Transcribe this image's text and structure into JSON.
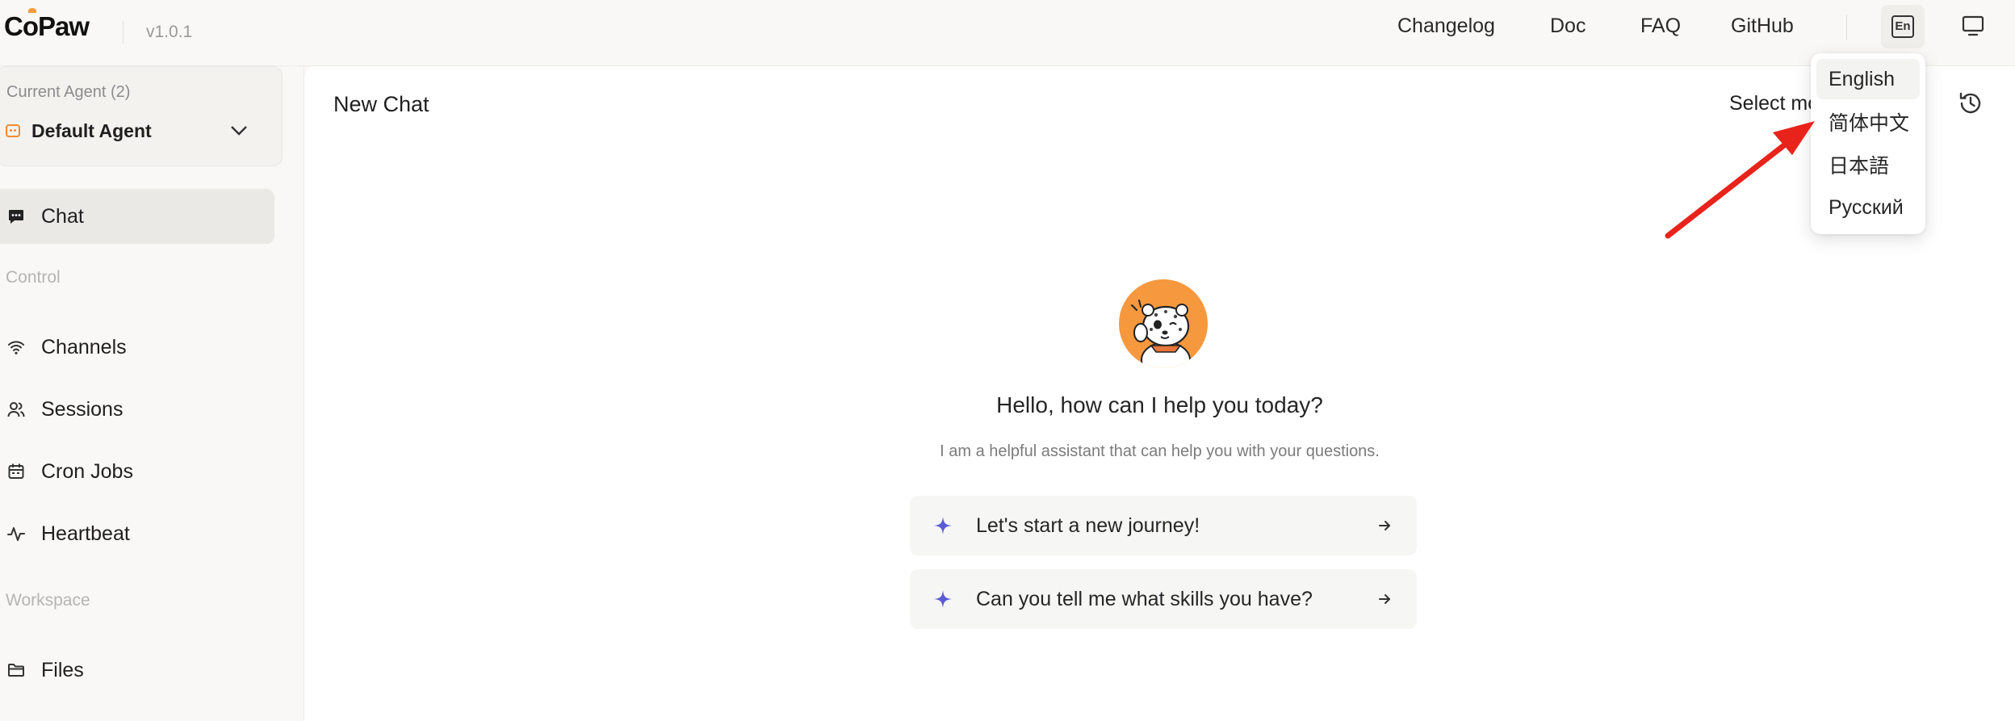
{
  "header": {
    "logo": "CoPaw",
    "version": "v1.0.1",
    "nav": [
      "Changelog",
      "Doc",
      "FAQ",
      "GitHub"
    ],
    "language_button_icon": "language-en-icon",
    "display_button_icon": "monitor-icon"
  },
  "sidebar": {
    "agent_caption": "Current Agent (2)",
    "agent_name": "Default Agent",
    "items": {
      "chat": "Chat",
      "control_section": "Control",
      "channels": "Channels",
      "sessions": "Sessions",
      "cron_jobs": "Cron Jobs",
      "heartbeat": "Heartbeat",
      "workspace_section": "Workspace",
      "files": "Files"
    }
  },
  "main": {
    "title": "New Chat",
    "select_model": "Select mo",
    "greeting": "Hello, how can I help you today?",
    "subtitle": "I am a helpful assistant that can help you with your questions.",
    "prompts": [
      "Let's start a new journey!",
      "Can you tell me what skills you have?"
    ]
  },
  "language_menu": {
    "options": [
      "English",
      "简体中文",
      "日本語",
      "Русский"
    ],
    "selected": "English"
  },
  "colors": {
    "accent_orange": "#f6983e",
    "spark_purple": "#5b5bd6",
    "arrow_red": "#e8231b"
  }
}
